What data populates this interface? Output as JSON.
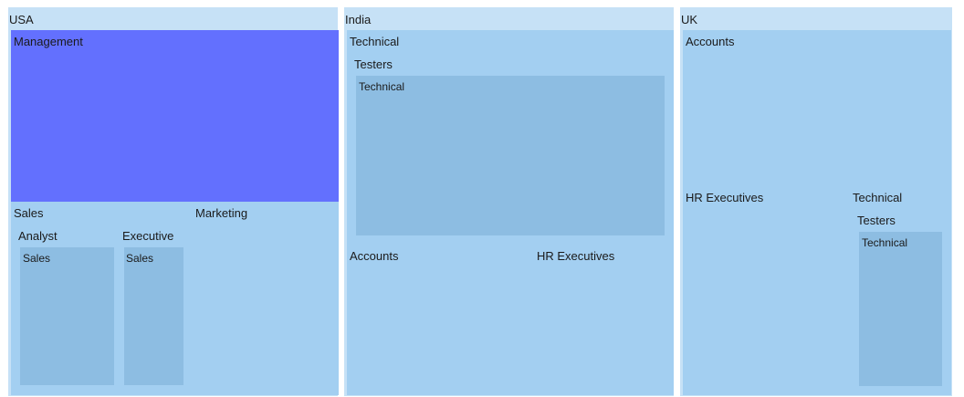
{
  "chart_data": {
    "type": "treemap",
    "colors": {
      "group": "#c6e1f6",
      "leaf": "#a3cff1",
      "leaf_deep": "#8dbde2",
      "highlight": "#6370fe"
    },
    "nodes": [
      {
        "name": "USA",
        "children": [
          {
            "name": "Management",
            "highlight": true
          },
          {
            "name": "Sales",
            "children": [
              {
                "name": "Analyst",
                "children": [
                  {
                    "name": "Sales"
                  }
                ]
              },
              {
                "name": "Executive",
                "children": [
                  {
                    "name": "Sales"
                  }
                ]
              }
            ]
          },
          {
            "name": "Marketing"
          }
        ]
      },
      {
        "name": "India",
        "children": [
          {
            "name": "Technical",
            "children": [
              {
                "name": "Testers",
                "children": [
                  {
                    "name": "Technical"
                  }
                ]
              }
            ]
          },
          {
            "name": "Accounts"
          },
          {
            "name": "HR Executives"
          }
        ]
      },
      {
        "name": "UK",
        "children": [
          {
            "name": "Accounts"
          },
          {
            "name": "HR Executives"
          },
          {
            "name": "Technical",
            "children": [
              {
                "name": "Testers",
                "children": [
                  {
                    "name": "Technical"
                  }
                ]
              }
            ]
          }
        ]
      }
    ]
  }
}
